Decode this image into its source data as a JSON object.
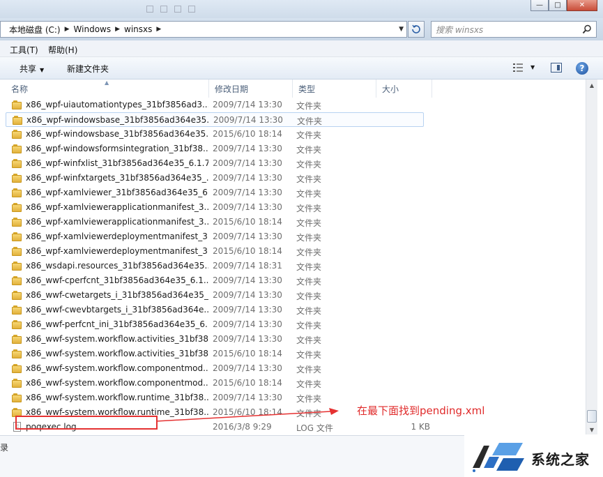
{
  "window": {
    "minimize_icon": "—",
    "maximize_icon": "□",
    "close_icon": "✕"
  },
  "address": {
    "crumbs": [
      "本地磁盘 (C:)",
      "Windows",
      "winsxs"
    ],
    "search_placeholder": "搜索 winsxs"
  },
  "menu": {
    "tools": "工具(T)",
    "help": "帮助(H)"
  },
  "toolbar": {
    "share": "共享",
    "new_folder": "新建文件夹"
  },
  "columns": {
    "name": "名称",
    "date": "修改日期",
    "type": "类型",
    "size": "大小"
  },
  "rows": [
    {
      "name": "x86_wpf-uiautomationtypes_31bf3856ad3...",
      "date": "2009/7/14 13:30",
      "type": "文件夹",
      "size": "",
      "icon": "folder-icon"
    },
    {
      "name": "x86_wpf-windowsbase_31bf3856ad364e35...",
      "date": "2009/7/14 13:30",
      "type": "文件夹",
      "size": "",
      "icon": "folder-icon",
      "selected": true
    },
    {
      "name": "x86_wpf-windowsbase_31bf3856ad364e35...",
      "date": "2015/6/10 18:14",
      "type": "文件夹",
      "size": "",
      "icon": "folder-icon"
    },
    {
      "name": "x86_wpf-windowsformsintegration_31bf38...",
      "date": "2009/7/14 13:30",
      "type": "文件夹",
      "size": "",
      "icon": "folder-icon"
    },
    {
      "name": "x86_wpf-winfxlist_31bf3856ad364e35_6.1.7...",
      "date": "2009/7/14 13:30",
      "type": "文件夹",
      "size": "",
      "icon": "folder-icon"
    },
    {
      "name": "x86_wpf-winfxtargets_31bf3856ad364e35_...",
      "date": "2009/7/14 13:30",
      "type": "文件夹",
      "size": "",
      "icon": "folder-icon"
    },
    {
      "name": "x86_wpf-xamlviewer_31bf3856ad364e35_6...",
      "date": "2009/7/14 13:30",
      "type": "文件夹",
      "size": "",
      "icon": "folder-icon"
    },
    {
      "name": "x86_wpf-xamlviewerapplicationmanifest_3...",
      "date": "2009/7/14 13:30",
      "type": "文件夹",
      "size": "",
      "icon": "folder-icon"
    },
    {
      "name": "x86_wpf-xamlviewerapplicationmanifest_3...",
      "date": "2015/6/10 18:14",
      "type": "文件夹",
      "size": "",
      "icon": "folder-icon"
    },
    {
      "name": "x86_wpf-xamlviewerdeploymentmanifest_3...",
      "date": "2009/7/14 13:30",
      "type": "文件夹",
      "size": "",
      "icon": "folder-icon"
    },
    {
      "name": "x86_wpf-xamlviewerdeploymentmanifest_3...",
      "date": "2015/6/10 18:14",
      "type": "文件夹",
      "size": "",
      "icon": "folder-icon"
    },
    {
      "name": "x86_wsdapi.resources_31bf3856ad364e35...",
      "date": "2009/7/14 18:31",
      "type": "文件夹",
      "size": "",
      "icon": "folder-icon"
    },
    {
      "name": "x86_wwf-cperfcnt_31bf3856ad364e35_6.1....",
      "date": "2009/7/14 13:30",
      "type": "文件夹",
      "size": "",
      "icon": "folder-icon"
    },
    {
      "name": "x86_wwf-cwetargets_i_31bf3856ad364e35_...",
      "date": "2009/7/14 13:30",
      "type": "文件夹",
      "size": "",
      "icon": "folder-icon"
    },
    {
      "name": "x86_wwf-cwevbtargets_i_31bf3856ad364e...",
      "date": "2009/7/14 13:30",
      "type": "文件夹",
      "size": "",
      "icon": "folder-icon"
    },
    {
      "name": "x86_wwf-perfcnt_ini_31bf3856ad364e35_6....",
      "date": "2009/7/14 13:30",
      "type": "文件夹",
      "size": "",
      "icon": "folder-icon"
    },
    {
      "name": "x86_wwf-system.workflow.activities_31bf38...",
      "date": "2009/7/14 13:30",
      "type": "文件夹",
      "size": "",
      "icon": "folder-icon"
    },
    {
      "name": "x86_wwf-system.workflow.activities_31bf38...",
      "date": "2015/6/10 18:14",
      "type": "文件夹",
      "size": "",
      "icon": "folder-icon"
    },
    {
      "name": "x86_wwf-system.workflow.componentmod...",
      "date": "2009/7/14 13:30",
      "type": "文件夹",
      "size": "",
      "icon": "folder-icon"
    },
    {
      "name": "x86_wwf-system.workflow.componentmod...",
      "date": "2015/6/10 18:14",
      "type": "文件夹",
      "size": "",
      "icon": "folder-icon"
    },
    {
      "name": "x86_wwf-system.workflow.runtime_31bf38...",
      "date": "2009/7/14 13:30",
      "type": "文件夹",
      "size": "",
      "icon": "folder-icon"
    },
    {
      "name": "x86_wwf-system.workflow.runtime_31bf38...",
      "date": "2015/6/10 18:14",
      "type": "文件夹",
      "size": "",
      "icon": "folder-icon"
    },
    {
      "name": "poqexec.log",
      "date": "2016/3/8 9:29",
      "type": "LOG 文件",
      "size": "1 KB",
      "icon": "log-file-icon"
    }
  ],
  "status": {
    "left_glyph": "录"
  },
  "annotation": {
    "text": "在最下面找到pending.xml",
    "color": "#e53131"
  },
  "watermark": {
    "text": "系统之家"
  },
  "colors": {
    "accent": "#2b5fa6",
    "folder": "#e2b23c",
    "annotation_red": "#e53131"
  }
}
